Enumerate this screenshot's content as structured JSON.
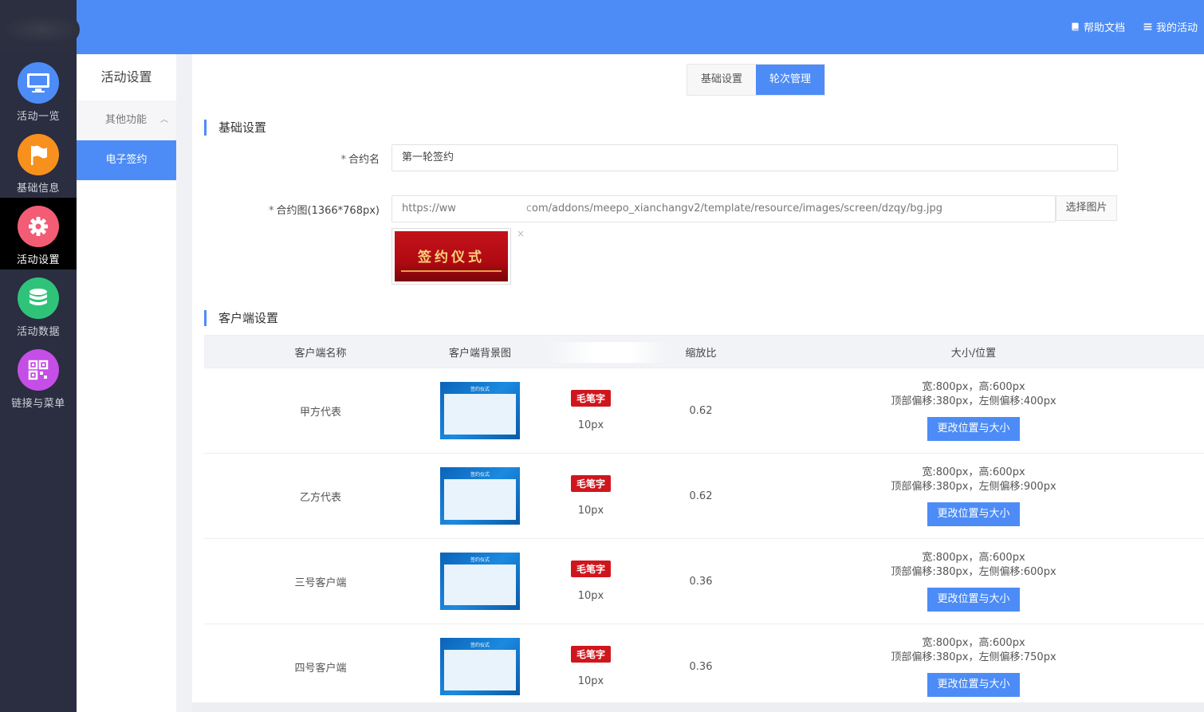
{
  "header": {
    "help_docs": "帮助文档",
    "my_activity": "我的活动"
  },
  "leftnav": [
    {
      "label": "活动一览",
      "icon": "monitor-icon",
      "color": "#4d8cf6",
      "active": false
    },
    {
      "label": "基础信息",
      "icon": "flag-icon",
      "color": "#f8901d",
      "active": false
    },
    {
      "label": "活动设置",
      "icon": "gear-icon",
      "color": "#f25c74",
      "active": true
    },
    {
      "label": "活动数据",
      "icon": "database-icon",
      "color": "#2fc37a",
      "active": false
    },
    {
      "label": "链接与菜单",
      "icon": "qrcode-icon",
      "color": "#c54ee6",
      "active": false
    }
  ],
  "submenu": {
    "title": "活动设置",
    "group": "其他功能",
    "item": "电子签约"
  },
  "tabs": [
    "基础设置",
    "轮次管理"
  ],
  "section_basic": "基础设置",
  "form": {
    "contract_name_label": "合约名",
    "contract_name_value": "第一轮签约",
    "contract_image_label": "合约图(1366*768px)",
    "contract_image_url_left": "https://ww",
    "contract_image_url_right": "com/addons/meepo_xianchangv2/template/resource/images/screen/dzqy/bg.jpg",
    "choose_image": "选择图片",
    "preview_title": "签约仪式",
    "required_mark": "*",
    "remove_mark": "×"
  },
  "section_client": "客户端设置",
  "table": {
    "headers": [
      "客户端名称",
      "客户端背景图",
      "",
      "缩放比",
      "大小/位置"
    ],
    "thumb_caption": "签约仪式",
    "rows": [
      {
        "name": "甲方代表",
        "font": "毛笔字",
        "font_size": "10px",
        "scale": "0.62",
        "size": "宽:800px，高:600px",
        "offset": "顶部偏移:380px，左侧偏移:400px",
        "button": "更改位置与大小"
      },
      {
        "name": "乙方代表",
        "font": "毛笔字",
        "font_size": "10px",
        "scale": "0.62",
        "size": "宽:800px，高:600px",
        "offset": "顶部偏移:380px，左侧偏移:900px",
        "button": "更改位置与大小"
      },
      {
        "name": "三号客户端",
        "font": "毛笔字",
        "font_size": "10px",
        "scale": "0.36",
        "size": "宽:800px，高:600px",
        "offset": "顶部偏移:380px，左侧偏移:600px",
        "button": "更改位置与大小"
      },
      {
        "name": "四号客户端",
        "font": "毛笔字",
        "font_size": "10px",
        "scale": "0.36",
        "size": "宽:800px，高:600px",
        "offset": "顶部偏移:380px，左侧偏移:750px",
        "button": "更改位置与大小"
      }
    ]
  }
}
